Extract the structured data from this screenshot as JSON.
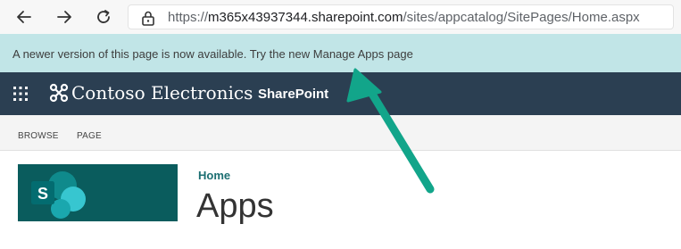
{
  "browser": {
    "url_prefix": "https://",
    "url_host": "m365x43937344.sharepoint.com",
    "url_path": "/sites/appcatalog/SitePages/Home.aspx",
    "icons": [
      "back-arrow-icon",
      "forward-arrow-icon",
      "refresh-icon",
      "lock-icon"
    ]
  },
  "banner": {
    "message": "A newer version of this page is now available.",
    "link_text": "Try the new Manage Apps page",
    "background": "#c1e5e7"
  },
  "suite_bar": {
    "org_name": "Contoso Electronics",
    "app_name": "SharePoint",
    "background": "#2b3f52"
  },
  "ribbon": {
    "tabs": [
      {
        "label": "BROWSE"
      },
      {
        "label": "PAGE"
      }
    ]
  },
  "page": {
    "breadcrumb": "Home",
    "title": "Apps",
    "logo_letter": "S",
    "logo_background": "#0a5c5d"
  },
  "annotation": {
    "arrow_color": "#12a58a"
  }
}
